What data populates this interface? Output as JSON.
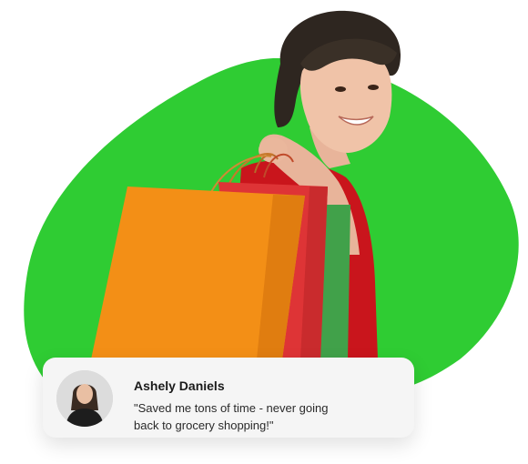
{
  "colors": {
    "blob_green": "#2fcc33",
    "card_background": "#f5f5f5",
    "shirt_red": "#c9151c",
    "bag_orange": "#f38f16",
    "bag_red": "#de3436",
    "bag_green": "#41a14a"
  },
  "illustration": {
    "subject": "woman-with-shopping-bags",
    "icon": "shopping-bags-icon"
  },
  "testimonial": {
    "name": "Ashely Daniels",
    "quote": "\"Saved me tons of time - never going back to grocery shopping!\"",
    "avatar_icon": "avatar-photo"
  }
}
